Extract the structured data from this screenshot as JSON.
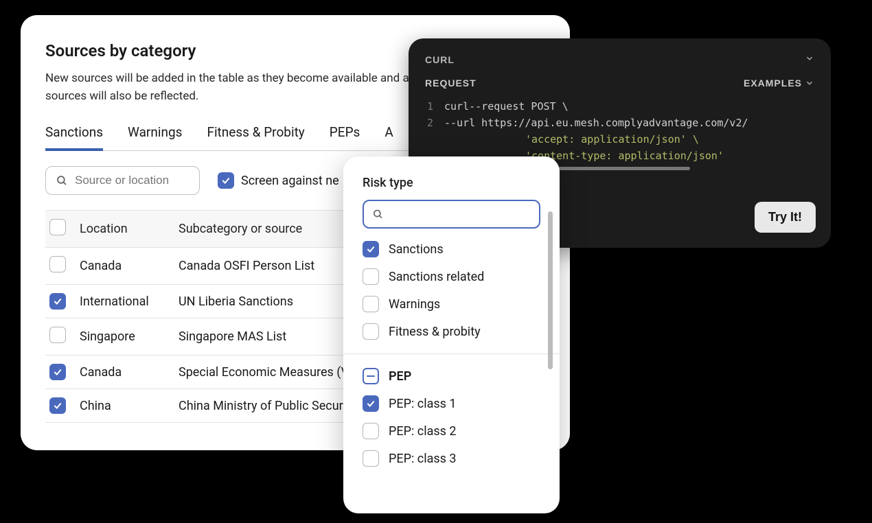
{
  "sources": {
    "title": "Sources by category",
    "description": "New sources will be added in the table as they become available and any changes to existing sources will also be reflected.",
    "tabs": [
      "Sanctions",
      "Warnings",
      "Fitness & Probity",
      "PEPs",
      "A"
    ],
    "active_tab": 0,
    "search_placeholder": "Source or location",
    "screen_label": "Screen against ne",
    "screen_checked": true,
    "columns": {
      "location": "Location",
      "subcategory": "Subcategory or source"
    },
    "rows": [
      {
        "checked": false,
        "location": "Canada",
        "sub": "Canada OSFI Person List"
      },
      {
        "checked": true,
        "location": "International",
        "sub": "UN Liberia Sanctions"
      },
      {
        "checked": false,
        "location": "Singapore",
        "sub": "Singapore MAS List"
      },
      {
        "checked": true,
        "location": "Canada",
        "sub": "Special Economic Measures (V"
      },
      {
        "checked": true,
        "location": "China",
        "sub": "China Ministry of Public Secur"
      }
    ]
  },
  "risk": {
    "title": "Risk type",
    "groups": [
      {
        "label": "Sanctions",
        "state": "checked"
      },
      {
        "label": "Sanctions related",
        "state": "unchecked"
      },
      {
        "label": "Warnings",
        "state": "unchecked"
      },
      {
        "label": "Fitness & probity",
        "state": "unchecked"
      }
    ],
    "pep_header": {
      "label": "PEP",
      "state": "indeterminate"
    },
    "pep_items": [
      {
        "label": "PEP: class 1",
        "state": "checked"
      },
      {
        "label": "PEP: class 2",
        "state": "unchecked"
      },
      {
        "label": "PEP: class 3",
        "state": "unchecked"
      }
    ]
  },
  "code": {
    "lang_label": "CURL",
    "section_label": "REQUEST",
    "examples_label": "EXAMPLES",
    "lines": [
      {
        "n": "1",
        "text_a": "curl ",
        "text_b": "--request POST \\"
      },
      {
        "n": "2",
        "text_a": "     ",
        "text_b": "--url https://api.eu.mesh.complyadvantage.com/v2/"
      },
      {
        "n": "",
        "text_a": "     ",
        "text_b": "'accept: application/json' \\",
        "string": true
      },
      {
        "n": "",
        "text_a": "     ",
        "text_b": "'content-type: application/json'",
        "string": true
      }
    ],
    "tryit_label": "Try It!"
  }
}
